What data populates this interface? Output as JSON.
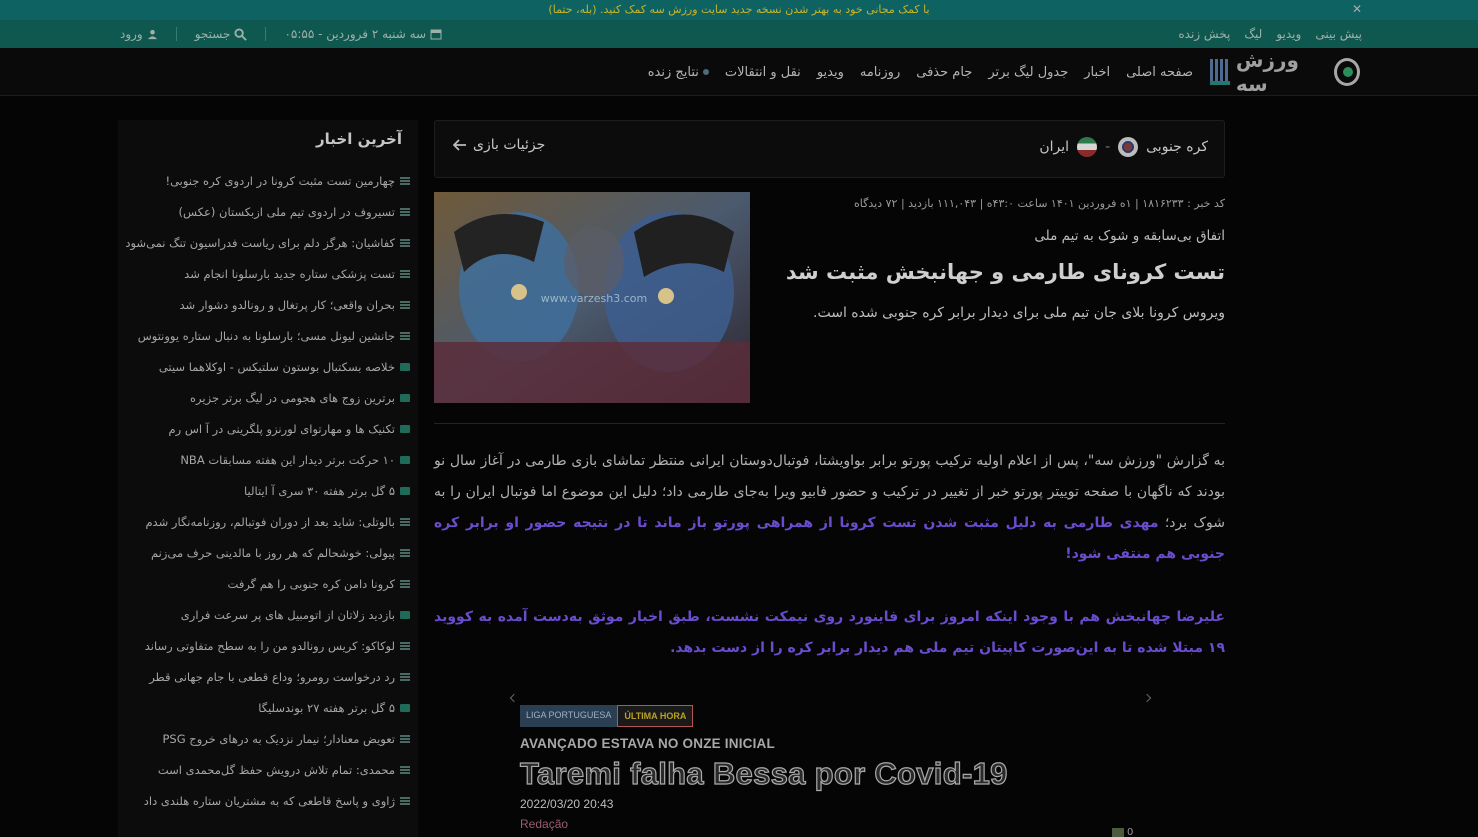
{
  "notice": {
    "text": "با کمک مجانی خود به بهتر شدن نسخه جدید سایت ورزش سه کمک کنید. (بله، حتما)"
  },
  "topbar": {
    "links": [
      "پیش بینی",
      "ویدیو",
      "لیگ",
      "پخش زنده"
    ],
    "date": "سه شنبه ۲ فروردین - ۰۵:۵۵",
    "search": "جستجو",
    "login": "ورود"
  },
  "nav": {
    "logo_text": "ورزش سه",
    "items": [
      "صفحه اصلی",
      "اخبار",
      "جدول لیگ برتر",
      "جام حذفی",
      "روزنامه",
      "ویدیو",
      "نقل و انتقالات",
      "نتایج زنده"
    ]
  },
  "match": {
    "home": "کره جنوبی",
    "away": "ایران",
    "separator": "-",
    "details": "جزئیات بازی"
  },
  "article": {
    "meta": "کد خبر : ۱۸۱۶۲۳۳ | ۱ه فروردین ۱۴۰۱ ساعت ۴۳:۰ه | ۱۱۱,۰۴۳ بازدید | ۷۲ دیدگاه",
    "kicker": "اتفاق بی‌سابقه و شوک به تیم ملی",
    "headline": "تست کرونای طارمی و جهانبخش مثبت شد",
    "lead": "ویروس کرونا بلای جان تیم ملی برای دیدار برابر کره جنوبی شده است.",
    "image_watermark": "www.varzesh3.com",
    "p1_plain": "به گزارش \"ورزش سه\"، پس از اعلام اولیه ترکیب پورتو برابر بواویشتا، فوتبال‌دوستان ایرانی منتظر تماشای بازی طارمی در آغاز سال نو بودند که ناگهان با صفحه توییتر پورتو خبر از تغییر در ترکیب و حضور فابیو ویرا به‌جای طارمی داد؛ دلیل این موضوع اما فوتبال ایران را به شوک برد؛ ",
    "p1_highlight": "مهدی طارمی به دلیل مثبت شدن تست کرونا از همراهی پورتو باز ماند تا در نتیجه حضور او برابر کره جنوبی هم منتفی شود!",
    "p2_highlight": "علیرضا جهانبخش هم با وجود اینکه امروز برای فاینورد روی نیمکت نشست، طبق اخبار موثق به‌دست آمده به کووید ۱۹ مبتلا شده تا به این‌صورت کاپیتان تیم ملی هم دیدار برابر کره را از دست بدهد."
  },
  "embed": {
    "tag_league": "LIGA PORTUGUESA",
    "tag_latest": "ÚLTIMA HORA",
    "subtitle": "AVANÇADO ESTAVA NO ONZE INICIAL",
    "title": "Taremi falha Bessa por Covid-19",
    "date": "2022/03/20 20:43",
    "author": "Redação",
    "comments": "0"
  },
  "sidebar": {
    "title": "آخرین اخبار",
    "items": [
      {
        "text": "چهارمین تست مثبت کرونا در اردوی کره جنوبی!",
        "type": "news"
      },
      {
        "text": "تسیروف در اردوی تیم ملی ازبکستان (عکس)",
        "type": "news"
      },
      {
        "text": "کفاشیان: هرگز دلم برای ریاست فدراسیون تنگ نمی‌شود",
        "type": "news"
      },
      {
        "text": "تست پزشکی ستاره جدید بارسلونا انجام شد",
        "type": "news"
      },
      {
        "text": "بحران واقعی؛ کار پرتغال و رونالدو دشوار شد",
        "type": "news"
      },
      {
        "text": "جانشین لیونل مسی؛ بارسلونا به دنبال ستاره یوونتوس",
        "type": "news"
      },
      {
        "text": "خلاصه بسکتبال بوستون سلتیکس - اوکلاهما سیتی",
        "type": "video"
      },
      {
        "text": "برترین زوج های هجومی در لیگ برتر جزیره",
        "type": "video"
      },
      {
        "text": "تکنیک ها و مهارتوای لورنزو پلگرینی در آ اس رم",
        "type": "video"
      },
      {
        "text": "۱۰ حرکت برتر دیدار این هفته مسابقات NBA",
        "type": "video"
      },
      {
        "text": "۵ گل برتر هفته ۳۰ سری آ ایتالیا",
        "type": "video"
      },
      {
        "text": "بالوتلی: شاید بعد از دوران فوتبالم، روزنامه‌نگار شدم",
        "type": "news"
      },
      {
        "text": "پیولی: خوشحالم که هر روز با مالدینی حرف می‌زنم",
        "type": "news"
      },
      {
        "text": "کرونا دامن کره جنوبی را هم گرفت",
        "type": "news"
      },
      {
        "text": "بازدید زلاتان از اتومبیل های پر سرعت فراری",
        "type": "video"
      },
      {
        "text": "لوکاکو: کریس رونالدو من را به سطح متفاوتی رساند",
        "type": "news"
      },
      {
        "text": "رد درخواست رومرو؛ وداع قطعی با جام جهانی قطر",
        "type": "news"
      },
      {
        "text": "۵ گل برتر هفته ۲۷ بوندسلیگا",
        "type": "video"
      },
      {
        "text": "تعویض معنادار؛ نیمار نزدیک به درهای خروج PSG",
        "type": "news"
      },
      {
        "text": "محمدی: تمام تلاش درویش حفظ گل‌محمدی است",
        "type": "news"
      },
      {
        "text": "ژاوی و پاسخ قاطعی که به مشتریان ستاره هلندی داد",
        "type": "news"
      }
    ]
  },
  "colors": {
    "topbar": "#0e584f",
    "notice": "#0f6262",
    "highlight": "#6a4ccf"
  }
}
